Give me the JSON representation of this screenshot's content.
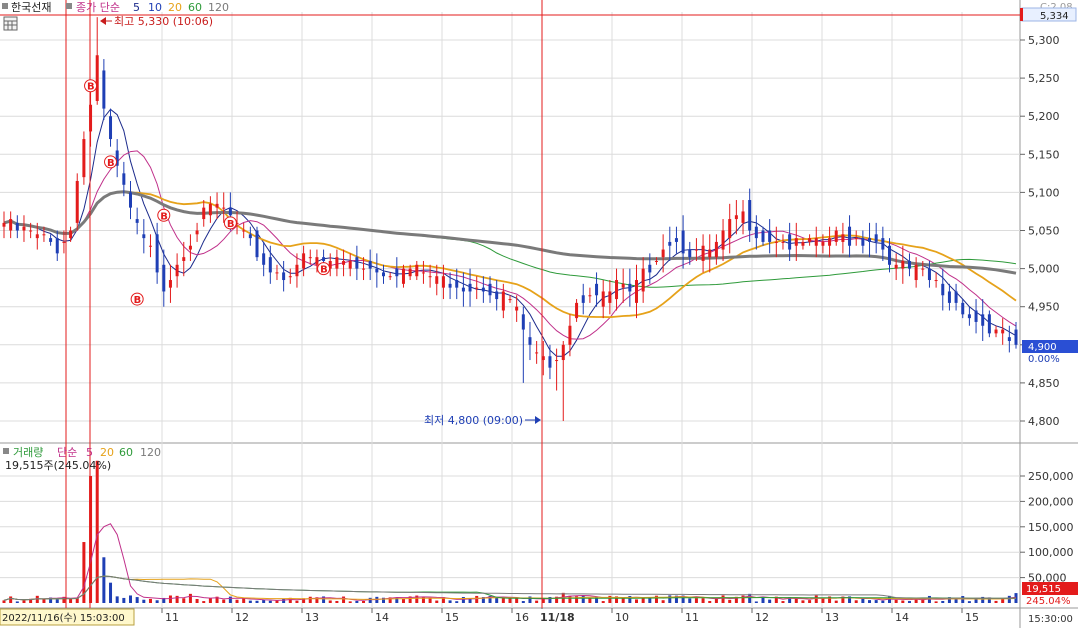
{
  "top_legend": {
    "symbol_label": "한국선재",
    "price_label": "종가 단순",
    "ma_5": "5",
    "ma_10": "10",
    "ma_20": "20",
    "ma_60": "60",
    "ma_120": "120"
  },
  "volume_legend": {
    "volume_label": "거래량",
    "ma_label": "단순",
    "ma_5": "5",
    "ma_20": "20",
    "ma_60": "60",
    "ma_120": "120",
    "volume_summary": "19,515주(245.04%)"
  },
  "annotations": {
    "high": "최고 5,330 (10:06)",
    "low": "최저 4,800 (09:00)",
    "buy_marker": "B"
  },
  "right_axis": {
    "top_change": "C:2.08",
    "current_high_box": "5,334",
    "current_price_box": "4,900",
    "current_change": "0.00%",
    "current_volume_box": "19,515",
    "current_volume_ratio": "245.04%",
    "time_label": "15:30:00"
  },
  "x_axis": {
    "current_date_box": "2022/11/16(수) 15:03:00",
    "date_marker": "11/18",
    "ticks": [
      "11",
      "12",
      "13",
      "14",
      "15",
      "16",
      "11/18",
      "10",
      "11",
      "12",
      "13",
      "14",
      "15"
    ]
  },
  "colors": {
    "up": "#e31b1b",
    "down": "#1f3fb5",
    "ma5": "#1c2b8c",
    "ma10": "#c0308a",
    "ma20": "#e6a21a",
    "ma60": "#2e9a3a",
    "ma120": "#7a7a7a",
    "grid": "#dcdcdc",
    "crosshair": "#e31b1b",
    "price_box": "#2a4fd4",
    "volume_box": "#e31b1b"
  },
  "chart_data": [
    {
      "type": "candlestick",
      "title": "한국선재 종가 단순 5 10 20 60 120",
      "x_ticks": [
        "11",
        "12",
        "13",
        "14",
        "15",
        "16",
        "11/18",
        "10",
        "11",
        "12",
        "13",
        "14",
        "15"
      ],
      "y_ticks": [
        5300,
        5250,
        5200,
        5150,
        5100,
        5050,
        5000,
        4950,
        4900,
        4850,
        4800
      ],
      "ylim": [
        4780,
        5340
      ],
      "high": 5330,
      "low": 4800,
      "current": 4900,
      "close_anchors": [
        [
          0,
          5060
        ],
        [
          2,
          5050
        ],
        [
          5,
          5040
        ],
        [
          8,
          5030
        ],
        [
          10,
          5050
        ],
        [
          12,
          5180
        ],
        [
          14,
          5250
        ],
        [
          16,
          5160
        ],
        [
          18,
          5100
        ],
        [
          20,
          5050
        ],
        [
          22,
          5020
        ],
        [
          24,
          4980
        ],
        [
          26,
          5010
        ],
        [
          28,
          5040
        ],
        [
          30,
          5070
        ],
        [
          32,
          5080
        ],
        [
          34,
          5070
        ],
        [
          36,
          5040
        ],
        [
          38,
          5020
        ],
        [
          40,
          5000
        ],
        [
          42,
          4990
        ],
        [
          44,
          5010
        ],
        [
          48,
          5010
        ],
        [
          52,
          5010
        ],
        [
          56,
          5000
        ],
        [
          60,
          5000
        ],
        [
          64,
          4990
        ],
        [
          68,
          4980
        ],
        [
          72,
          4980
        ],
        [
          76,
          4960
        ],
        [
          78,
          4920
        ],
        [
          80,
          4880
        ],
        [
          82,
          4880
        ],
        [
          83,
          4890
        ],
        [
          84,
          4900
        ],
        [
          86,
          4960
        ],
        [
          88,
          4970
        ],
        [
          90,
          4960
        ],
        [
          92,
          4980
        ],
        [
          94,
          4960
        ],
        [
          96,
          4990
        ],
        [
          98,
          5020
        ],
        [
          100,
          5040
        ],
        [
          102,
          5030
        ],
        [
          104,
          5020
        ],
        [
          106,
          5020
        ],
        [
          108,
          5040
        ],
        [
          110,
          5070
        ],
        [
          112,
          5060
        ],
        [
          114,
          5040
        ],
        [
          116,
          5040
        ],
        [
          118,
          5030
        ],
        [
          120,
          5030
        ],
        [
          122,
          5030
        ],
        [
          124,
          5040
        ],
        [
          126,
          5040
        ],
        [
          128,
          5040
        ],
        [
          130,
          5040
        ],
        [
          132,
          5030
        ],
        [
          134,
          5000
        ],
        [
          136,
          5000
        ],
        [
          138,
          4990
        ],
        [
          140,
          4980
        ],
        [
          142,
          4960
        ],
        [
          144,
          4950
        ],
        [
          146,
          4930
        ],
        [
          148,
          4920
        ],
        [
          150,
          4910
        ],
        [
          152,
          4900
        ]
      ]
    },
    {
      "type": "bar",
      "title": "거래량 단순 5 20 60 120",
      "y_ticks": [
        250000,
        200000,
        150000,
        100000,
        50000
      ],
      "ylim": [
        0,
        280000
      ],
      "current_volume": 19515,
      "spikes": [
        [
          12,
          120000
        ],
        [
          13,
          250000
        ],
        [
          14,
          280000
        ],
        [
          15,
          90000
        ],
        [
          16,
          40000
        ],
        [
          28,
          18000
        ],
        [
          84,
          20000
        ],
        [
          100,
          15000
        ],
        [
          112,
          18000
        ],
        [
          152,
          12000
        ]
      ]
    }
  ]
}
